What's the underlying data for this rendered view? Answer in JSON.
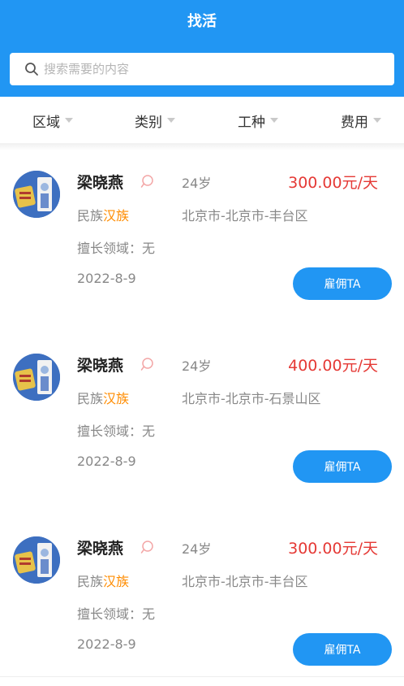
{
  "header": {
    "title": "找活"
  },
  "search": {
    "placeholder": "搜索需要的内容"
  },
  "filters": [
    {
      "label": "区域"
    },
    {
      "label": "类别"
    },
    {
      "label": "工种"
    },
    {
      "label": "费用"
    }
  ],
  "workers": [
    {
      "name": "梁晓燕",
      "age": "24岁",
      "price": "300.00元/天",
      "ethnic_label": "民族",
      "ethnic_value": "汉族",
      "location": "北京市-北京市-丰台区",
      "skill": "擅长领域：无",
      "date": "2022-8-9",
      "button": "雇佣TA"
    },
    {
      "name": "梁晓燕",
      "age": "24岁",
      "price": "400.00元/天",
      "ethnic_label": "民族",
      "ethnic_value": "汉族",
      "location": "北京市-北京市-石景山区",
      "skill": "擅长领域：无",
      "date": "2022-8-9",
      "button": "雇佣TA"
    },
    {
      "name": "梁晓燕",
      "age": "24岁",
      "price": "300.00元/天",
      "ethnic_label": "民族",
      "ethnic_value": "汉族",
      "location": "北京市-北京市-丰台区",
      "skill": "擅长领域：无",
      "date": "2022-8-9",
      "button": "雇佣TA"
    }
  ],
  "colors": {
    "primary": "#2196f3",
    "price": "#e53935",
    "ethnic_value": "#ff8c00",
    "muted_text": "#888888"
  }
}
